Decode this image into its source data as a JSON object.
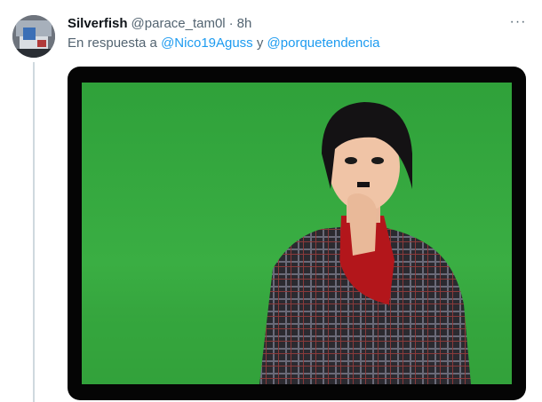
{
  "tweet": {
    "author_name": "Silverfish",
    "author_handle": "@parace_tam0l",
    "separator": "·",
    "time": "8h",
    "reply_prefix": "En respuesta a ",
    "mention_1": "@Nico19Aguss",
    "reply_conjunction": " y ",
    "mention_2": "@porquetendencia",
    "more_icon_glyph": "···"
  },
  "media": {
    "description_icon": "photo",
    "background_color": "#2f9e3a"
  },
  "colors": {
    "link": "#1d9bf0",
    "secondary_text": "#536471",
    "primary_text": "#0f1419"
  }
}
